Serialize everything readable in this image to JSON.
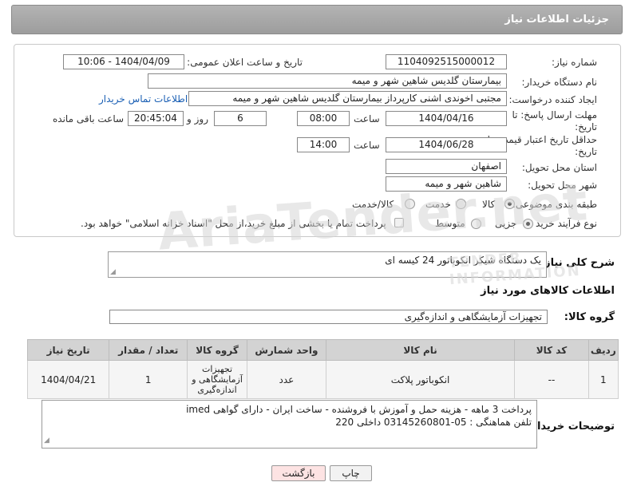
{
  "page": {
    "title": "جزئیات اطلاعات نیاز"
  },
  "form": {
    "need_number": {
      "label": "شماره نیاز:",
      "value": "1104092515000012"
    },
    "announce_date": {
      "label": "تاریخ و ساعت اعلان عمومی:",
      "value": "1404/04/09 - 10:06"
    },
    "buyer_org": {
      "label": "نام دستگاه خریدار:",
      "value": "بیمارستان گلدیس  شاهین شهر و میمه"
    },
    "requester": {
      "label": "ایجاد کننده درخواست:",
      "value": "مجتبی اخوندی اشنی کارپرداز بیمارستان گلدیس  شاهین شهر و میمه",
      "contact_link": "اطلاعات تماس خریدار"
    },
    "reply_deadline": {
      "label": "مهلت ارسال پاسخ: تا تاریخ:",
      "date": "1404/04/16",
      "time_label": "ساعت",
      "time": "08:00",
      "days": "6",
      "days_label": "روز و",
      "remaining": "20:45:04",
      "remaining_label": "ساعت باقی مانده"
    },
    "price_validity": {
      "label": "حداقل تاریخ اعتبار قیمت: تا تاریخ:",
      "date": "1404/06/28",
      "time_label": "ساعت",
      "time": "14:00"
    },
    "province": {
      "label": "استان محل تحویل:",
      "value": "اصفهان"
    },
    "city": {
      "label": "شهر محل تحویل:",
      "value": "شاهین شهر و میمه"
    },
    "category": {
      "label": "طبقه بندی موضوعی:",
      "options": [
        "کالا",
        "خدمت",
        "کالا/خدمت"
      ],
      "selected": "کالا"
    },
    "purchase_type": {
      "label": "نوع فرآیند خرید :",
      "options": [
        "جزیی",
        "متوسط"
      ],
      "selected": "جزیی",
      "note": "پرداخت تمام یا بخشی از مبلغ خرید،از محل \"اسناد خزانه اسلامی\" خواهد بود."
    }
  },
  "description": {
    "label": "شرح کلی نیاز:",
    "value": "یک دستگاه شیکر انکوباتور 24 کیسه ای"
  },
  "goods_section": {
    "title": "اطلاعات کالاهای مورد نیاز",
    "group_label": "گروه کالا:",
    "group_value": "تجهیزات آزمایشگاهی و اندازه‌گیری"
  },
  "table": {
    "headers": [
      "ردیف",
      "کد کالا",
      "نام کالا",
      "واحد شمارش",
      "گروه کالا",
      "تعداد / مقدار",
      "تاریخ نیاز"
    ],
    "rows": [
      [
        "1",
        "--",
        "انکوباتور پلاکت",
        "عدد",
        "تجهیزات آزمایشگاهی و اندازه‌گیری",
        "1",
        "1404/04/21"
      ]
    ]
  },
  "buyer_notes": {
    "label": "توضیحات خریدار:",
    "line1": "پرداخت 3 ماهه - هزینه حمل و آموزش با فروشنده - ساخت ایران - دارای گواهی imed",
    "line2": "تلفن هماهنگی : 05-03145260801 داخلی 220"
  },
  "buttons": {
    "print": "چاپ",
    "back": "بازگشت"
  },
  "watermark": {
    "brand": "AriaTender.net",
    "tagline": "TENDER INFORMATION"
  },
  "colors": {
    "header_bg": "#a6a6a6",
    "link": "#1a5fb4",
    "back_button_bg": "#fde3e3",
    "table_header_bg": "#d3d3d3"
  }
}
